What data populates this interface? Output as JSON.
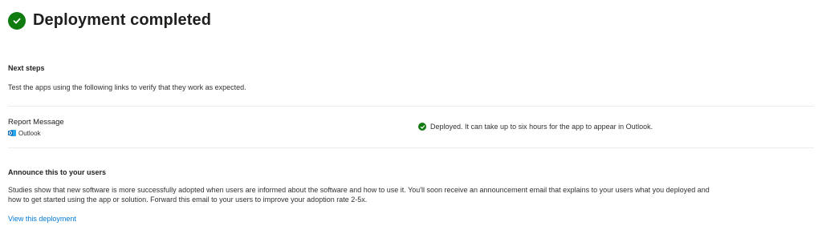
{
  "header": {
    "title": "Deployment completed"
  },
  "next_steps": {
    "title": "Next steps",
    "description": "Test the apps using the following links to verify that they work as expected."
  },
  "app_row": {
    "name": "Report Message",
    "host": "Outlook",
    "status": "Deployed. It can take up to six hours for the app to appear in Outlook."
  },
  "announce": {
    "title": "Announce this to your users",
    "line1": "Studies show that new software is more successfully adopted when users are informed about the software and how to use it. You'll soon receive an announcement email that explains to your users what you deployed and",
    "line2": "how to get started using the app or solution. Forward this email to your users to improve your adoption rate 2-5x."
  },
  "links": {
    "view_deployment": "View this deployment"
  },
  "colors": {
    "success": "#107c10",
    "link": "#0078d4",
    "outlook_blue": "#0364b8"
  },
  "icons": {
    "header": "check-circle-icon",
    "status": "check-circle-icon",
    "app": "outlook-icon"
  }
}
